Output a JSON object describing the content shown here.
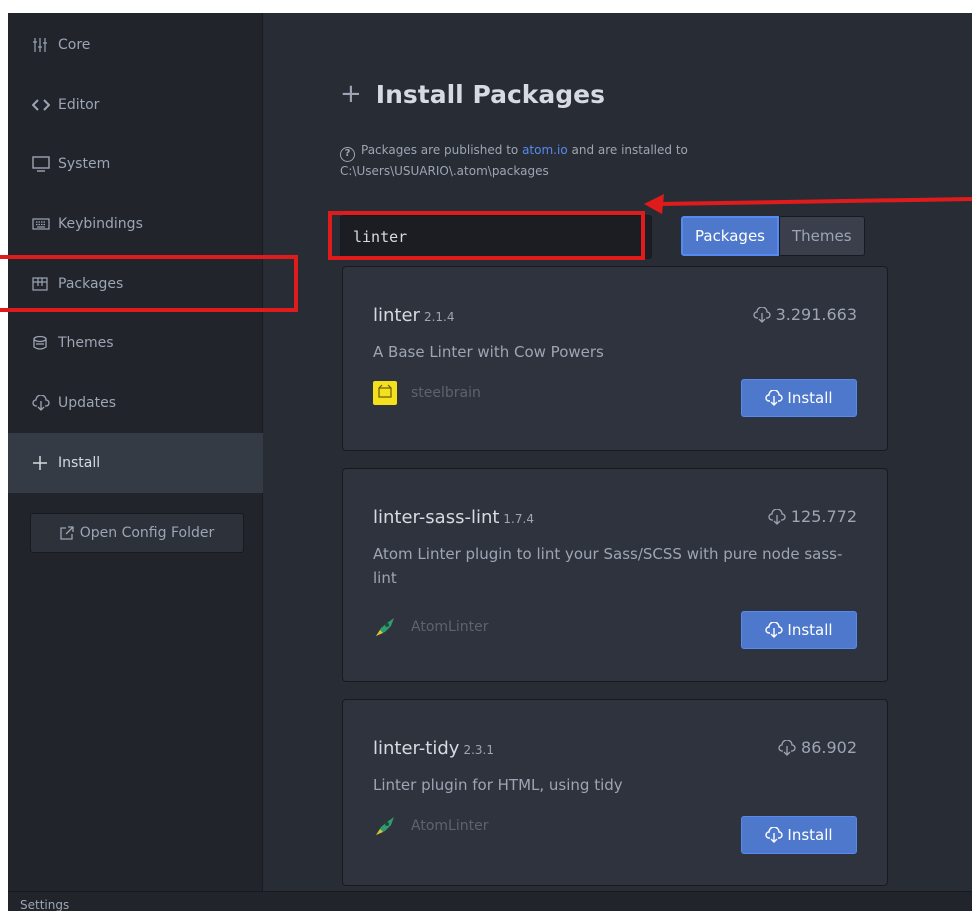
{
  "sidebar": {
    "items": [
      {
        "label": "Core",
        "icon": "sliders-icon"
      },
      {
        "label": "Editor",
        "icon": "code-icon"
      },
      {
        "label": "System",
        "icon": "monitor-icon"
      },
      {
        "label": "Keybindings",
        "icon": "keyboard-icon"
      },
      {
        "label": "Packages",
        "icon": "package-icon"
      },
      {
        "label": "Themes",
        "icon": "paintcan-icon"
      },
      {
        "label": "Updates",
        "icon": "cloud-download-icon"
      },
      {
        "label": "Install",
        "icon": "plus-icon",
        "selected": true
      }
    ],
    "open_config_label": "Open Config Folder"
  },
  "main": {
    "title": "Install Packages",
    "info_prefix": "Packages are published to ",
    "info_link": "atom.io",
    "info_suffix": " and are installed to",
    "info_path": "C:\\Users\\USUARIO\\.atom\\packages",
    "search_value": "linter",
    "toggle": {
      "packages_label": "Packages",
      "themes_label": "Themes",
      "active": "Packages"
    }
  },
  "packages": [
    {
      "name": "linter",
      "version": "2.1.4",
      "downloads": "3.291.663",
      "description": "A Base Linter with Cow Powers",
      "owner": "steelbrain",
      "install_label": "Install"
    },
    {
      "name": "linter-sass-lint",
      "version": "1.7.4",
      "downloads": "125.772",
      "description": "Atom Linter plugin to lint your Sass/SCSS with pure node sass-lint",
      "owner": "AtomLinter",
      "install_label": "Install"
    },
    {
      "name": "linter-tidy",
      "version": "2.3.1",
      "downloads": "86.902",
      "description": "Linter plugin for HTML, using tidy",
      "owner": "AtomLinter",
      "install_label": "Install"
    }
  ],
  "status_bar": {
    "text": "Settings"
  },
  "colors": {
    "accent": "#4d78cc",
    "link": "#568af2",
    "annotation": "#e01b1b",
    "background": "#282c34",
    "sidebar": "#21252b"
  }
}
